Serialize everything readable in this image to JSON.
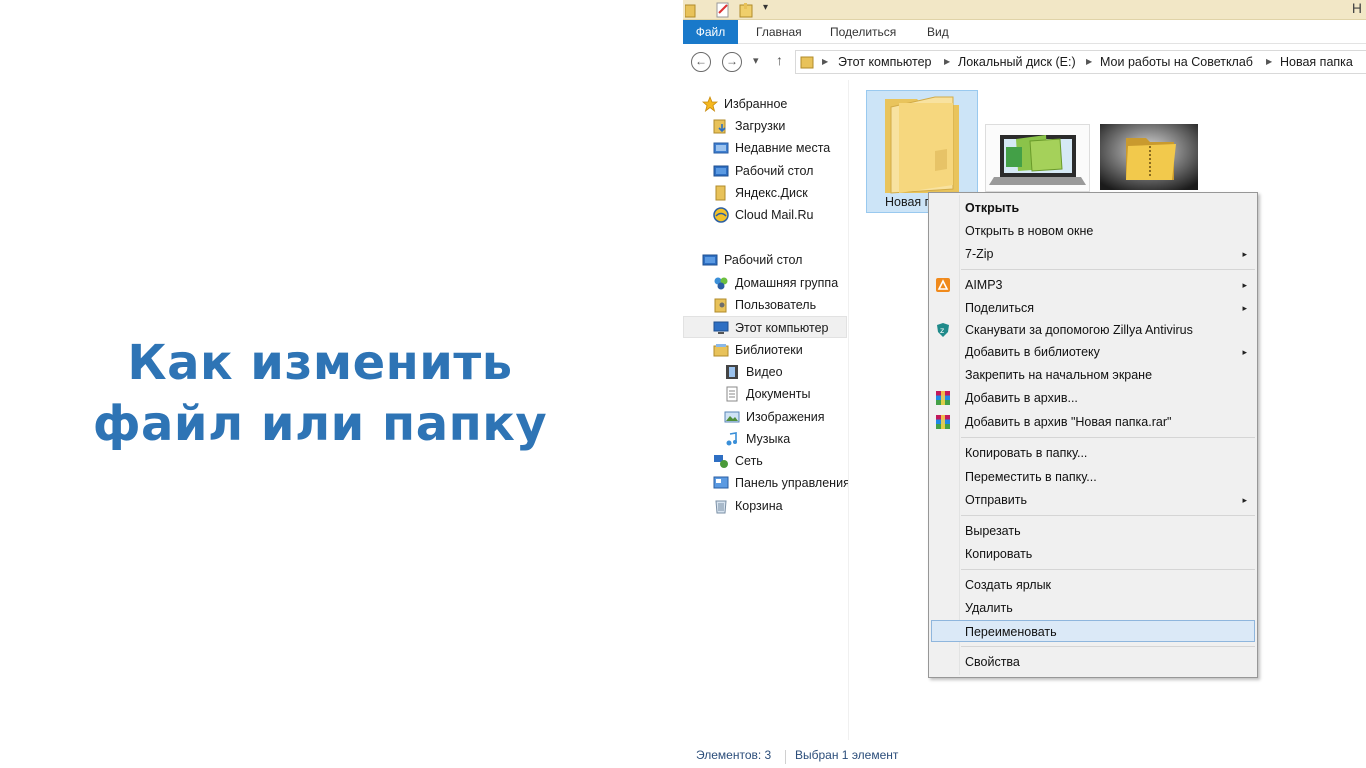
{
  "slide": {
    "title_line1": "Как изменить",
    "title_line2": "файл или папку"
  },
  "window": {
    "title_partial": "Н",
    "ribbon_tabs": [
      "Файл",
      "Главная",
      "Поделиться",
      "Вид"
    ]
  },
  "address": {
    "crumbs": [
      "Этот компьютер",
      "Локальный диск (E:)",
      "Мои работы на Советклаб",
      "Новая папка"
    ]
  },
  "nav": {
    "favorites": "Избранное",
    "downloads": "Загрузки",
    "recent": "Недавние места",
    "desktop_fav": "Рабочий стол",
    "yandex": "Яндекс.Диск",
    "cloudmail": "Cloud Mail.Ru",
    "desktop": "Рабочий стол",
    "homegroup": "Домашняя группа",
    "user": "Пользователь",
    "computer": "Этот компьютер",
    "libraries": "Библиотеки",
    "video": "Видео",
    "documents": "Документы",
    "images": "Изображения",
    "music": "Музыка",
    "network": "Сеть",
    "control_panel": "Панель управления",
    "recycle": "Корзина"
  },
  "content": {
    "selected_folder_label": "Новая п"
  },
  "context_menu": {
    "open": "Открыть",
    "open_new_window": "Открыть в новом окне",
    "sevenzip": "7-Zip",
    "aimp": "AIMP3",
    "share": "Поделиться",
    "scan": "Сканувати за допомогою Zillya Antivirus",
    "add_library": "Добавить в библиотеку",
    "pin_start": "Закрепить на начальном экране",
    "add_archive": "Добавить в архив...",
    "add_archive_rar": "Добавить в архив \"Новая папка.rar\"",
    "copy_to": "Копировать в папку...",
    "move_to": "Переместить в папку...",
    "send_to": "Отправить",
    "cut": "Вырезать",
    "copy": "Копировать",
    "create_shortcut": "Создать ярлык",
    "delete": "Удалить",
    "rename": "Переименовать",
    "properties": "Свойства",
    "submenu_arrow": "▸"
  },
  "status": {
    "items_count": "Элементов: 3",
    "selected": "Выбран 1 элемент"
  },
  "colors": {
    "title_blue": "#2e74b5",
    "file_tab": "#1979ca",
    "highlight": "#dbe9f7",
    "folder_yellow": "#f4d47a"
  }
}
